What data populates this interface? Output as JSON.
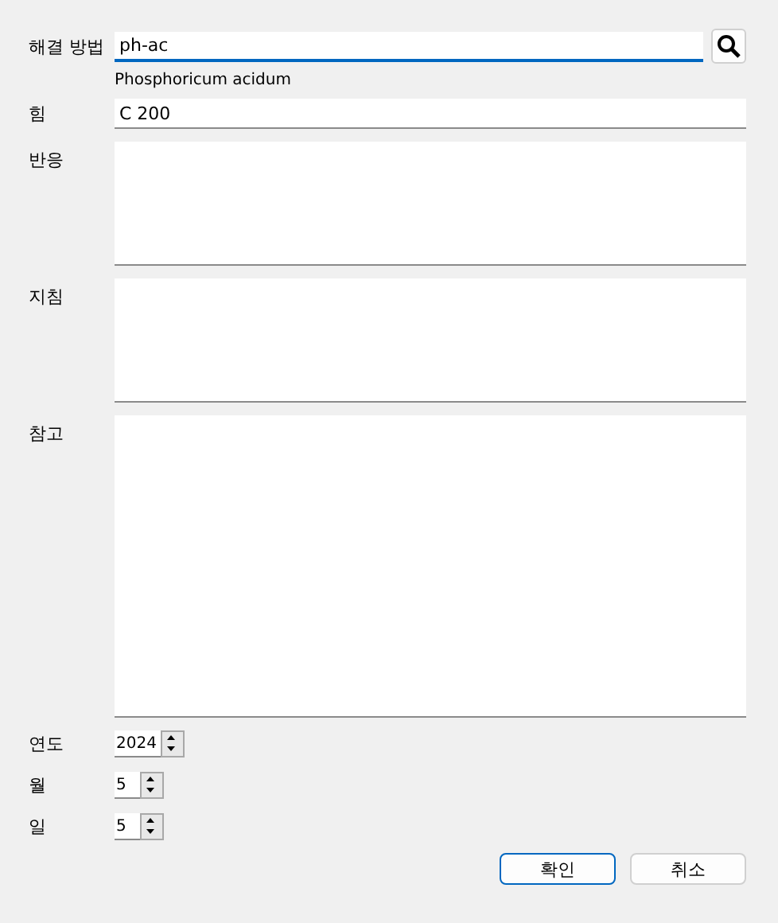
{
  "remedy": {
    "label": "해결 방법",
    "value": "ph-ac",
    "focused": true,
    "description": "Phosphoricum acidum"
  },
  "potency": {
    "label": "힘",
    "value": "C 200"
  },
  "text_areas": [
    {
      "label": "반응"
    },
    {
      "label": "지침"
    },
    {
      "label": "참고"
    }
  ],
  "spinners": [
    {
      "label": "연도",
      "value": "2024"
    },
    {
      "label": "월",
      "value": "5"
    },
    {
      "label": "일",
      "value": "5"
    }
  ],
  "buttons": [
    {
      "label": "확인",
      "default": true
    },
    {
      "label": "취소",
      "default": false
    }
  ]
}
